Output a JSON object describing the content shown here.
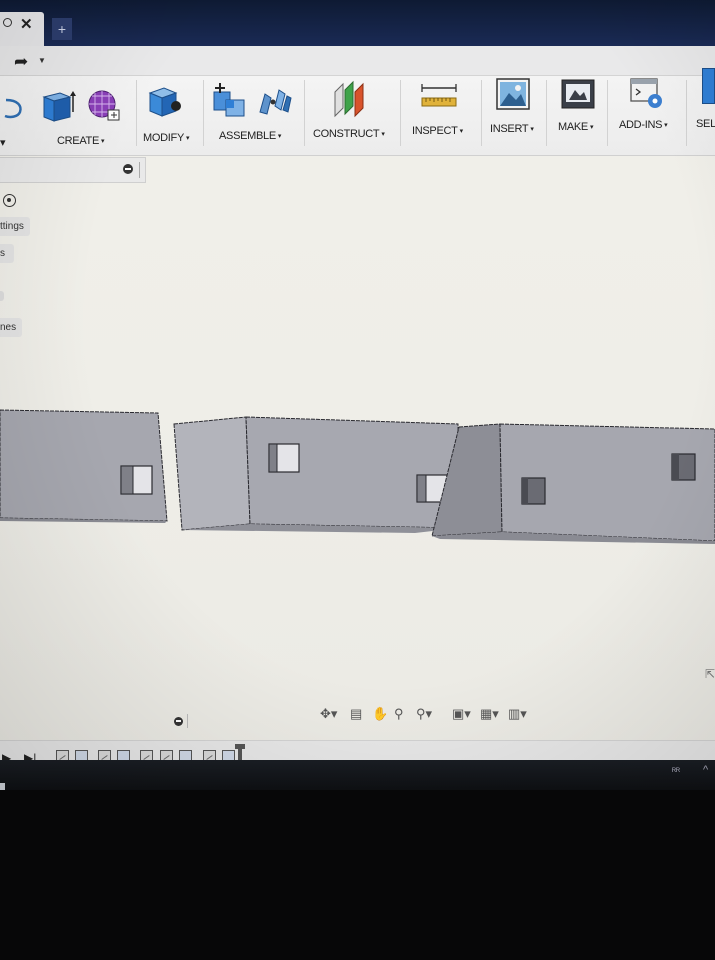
{
  "tabs": {
    "document_tab_close": "✕",
    "new_tab": "+"
  },
  "quick_access": {
    "redo_icon": "redo-icon"
  },
  "toolbar": {
    "groups": [
      {
        "label": "CREATE"
      },
      {
        "label": "MODIFY"
      },
      {
        "label": "ASSEMBLE"
      },
      {
        "label": "CONSTRUCT"
      },
      {
        "label": "INSPECT"
      },
      {
        "label": "INSERT"
      },
      {
        "label": "MAKE"
      },
      {
        "label": "ADD-INS"
      },
      {
        "label": "SEL"
      }
    ],
    "caret": "▾"
  },
  "browser": {
    "rows": [
      {
        "label": "ttings"
      },
      {
        "label": "s"
      },
      {
        "label": "nes"
      }
    ]
  },
  "navigation_bar": {
    "icons": [
      "orbit-icon",
      "look-at-icon",
      "pan-hand-icon",
      "zoom-icon",
      "fit-icon",
      "display-settings-icon",
      "grid-icon",
      "viewports-icon"
    ]
  },
  "timeline": {
    "controls": [
      "▶",
      "▶|"
    ],
    "feature_count": 11
  },
  "taskbar": {
    "user_initials": "ᴿᴿ",
    "chevron": "^"
  },
  "colors": {
    "canvas": "#efeee8",
    "toolbar": "#efefef",
    "model_face": "#a6a7af",
    "model_face_light": "#b3b4bb",
    "model_edge": "#2a2a30",
    "title_bar": "#14234a"
  }
}
